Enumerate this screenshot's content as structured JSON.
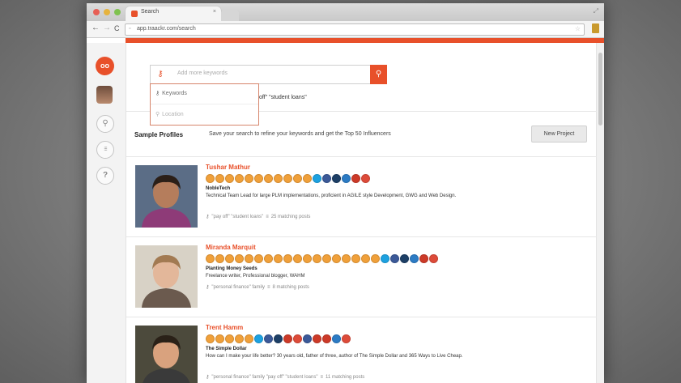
{
  "browser": {
    "tab_title": "Search",
    "tab_close": "×",
    "url": "app.traackr.com/search",
    "nav": {
      "back": "←",
      "forward": "→",
      "reload": "C"
    }
  },
  "sidebar": {
    "logo_text": "oo",
    "items": [
      {
        "icon": "search-icon",
        "glyph": "⚲"
      },
      {
        "icon": "grid-icon",
        "glyph": "⁝⁝⁝"
      },
      {
        "icon": "help-icon",
        "glyph": "?"
      }
    ]
  },
  "search": {
    "placeholder": "Add more keywords",
    "go_glyph": "⚲",
    "key_glyph": "⚷",
    "dropdown": [
      {
        "label": "Keywords",
        "glyph": "⚷",
        "color": "#6f6f6f"
      },
      {
        "label": "Location",
        "glyph": "⚲",
        "color": "#b2b2b2"
      }
    ],
    "query_text": "off\" \"student loans\""
  },
  "sample_profiles": {
    "title": "Sample Profiles",
    "description": "Save your search to refine your keywords and get the Top 50 Influencers",
    "button": "New Project"
  },
  "profiles": [
    {
      "name": "Tushar Mathur",
      "org": "NobleTech",
      "bio": "Technical Team Lead for large PLM implementations, proficient in AGILE style Development, GWG and Web Design.",
      "meta_keywords": "\"pay off\" \"student loans\"",
      "meta_posts": "25 matching posts",
      "badge_colors": [
        "#f0a03a",
        "#f0a03a",
        "#f0a03a",
        "#f0a03a",
        "#f0a03a",
        "#f0a03a",
        "#f0a03a",
        "#f0a03a",
        "#f0a03a",
        "#f0a03a",
        "#f0a03a",
        "#1da1e0",
        "#3b5998",
        "#1d3f66",
        "#2c7bc4",
        "#cc3a28",
        "#dd4b39"
      ],
      "photo": {
        "bg": "#5b6d86",
        "skin": "#b57d5c",
        "hair": "#2b1f18",
        "shirt": "#8e3b78"
      }
    },
    {
      "name": "Miranda Marquit",
      "org": "Planting Money Seeds",
      "bio": "Freelance writer, Professional blogger, WAHM",
      "meta_keywords": "\"personal finance\" family",
      "meta_posts": "8 matching posts",
      "badge_colors": [
        "#f0a03a",
        "#f0a03a",
        "#f0a03a",
        "#f0a03a",
        "#f0a03a",
        "#f0a03a",
        "#f0a03a",
        "#f0a03a",
        "#f0a03a",
        "#f0a03a",
        "#f0a03a",
        "#f0a03a",
        "#f0a03a",
        "#f0a03a",
        "#f0a03a",
        "#f0a03a",
        "#f0a03a",
        "#f0a03a",
        "#1da1e0",
        "#3b5998",
        "#1d3f66",
        "#2c7bc4",
        "#cc3a28",
        "#dd4b39"
      ],
      "photo": {
        "bg": "#d8d2c6",
        "skin": "#e3b79a",
        "hair": "#a27a52",
        "shirt": "#6b5a4e"
      }
    },
    {
      "name": "Trent Hamm",
      "org": "The Simple Dollar",
      "bio": "How can I make your life better? 30 years old, father of three, author of The Simple Dollar and 365 Ways to Live Cheap.",
      "meta_keywords": "\"personal finance\" family  \"pay off\" \"student loans\"",
      "meta_posts": "11 matching posts",
      "badge_colors": [
        "#f0a03a",
        "#f0a03a",
        "#f0a03a",
        "#f0a03a",
        "#f0a03a",
        "#1da1e0",
        "#3b5998",
        "#1d3f66",
        "#cc3a28",
        "#dd4b39",
        "#3b5998",
        "#cc3a28",
        "#cc3a28",
        "#2c7bc4",
        "#dd4b39"
      ],
      "photo": {
        "bg": "#4c4a3c",
        "skin": "#d9a27e",
        "hair": "#2a2118",
        "shirt": "#3a3a3a"
      }
    }
  ],
  "meta_icons": {
    "keyword": "⚷",
    "posts": "≡"
  },
  "colors": {
    "accent": "#e8502a",
    "traffic_red": "#e75f55",
    "traffic_yellow": "#e6b33d",
    "traffic_green": "#7fc24f"
  }
}
